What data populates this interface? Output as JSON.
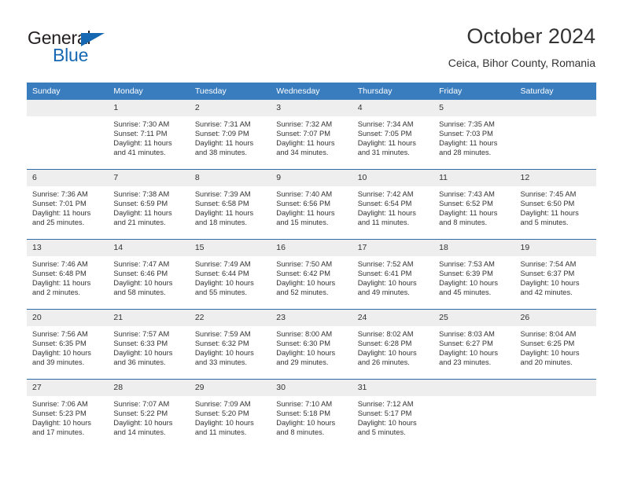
{
  "brand": {
    "name_part1": "General",
    "name_part2": "Blue",
    "accent_color": "#1668b3"
  },
  "header": {
    "month_title": "October 2024",
    "location": "Ceica, Bihor County, Romania"
  },
  "calendar": {
    "header_color": "#3a7dbf",
    "weekday_headers": [
      "Sunday",
      "Monday",
      "Tuesday",
      "Wednesday",
      "Thursday",
      "Friday",
      "Saturday"
    ],
    "weeks": [
      [
        {
          "day": "",
          "blank": true
        },
        {
          "day": "1",
          "sunrise": "Sunrise: 7:30 AM",
          "sunset": "Sunset: 7:11 PM",
          "daylight": "Daylight: 11 hours and 41 minutes."
        },
        {
          "day": "2",
          "sunrise": "Sunrise: 7:31 AM",
          "sunset": "Sunset: 7:09 PM",
          "daylight": "Daylight: 11 hours and 38 minutes."
        },
        {
          "day": "3",
          "sunrise": "Sunrise: 7:32 AM",
          "sunset": "Sunset: 7:07 PM",
          "daylight": "Daylight: 11 hours and 34 minutes."
        },
        {
          "day": "4",
          "sunrise": "Sunrise: 7:34 AM",
          "sunset": "Sunset: 7:05 PM",
          "daylight": "Daylight: 11 hours and 31 minutes."
        },
        {
          "day": "5",
          "sunrise": "Sunrise: 7:35 AM",
          "sunset": "Sunset: 7:03 PM",
          "daylight": "Daylight: 11 hours and 28 minutes."
        },
        {
          "day": "",
          "blank": true
        }
      ],
      [
        {
          "day": "6",
          "sunrise": "Sunrise: 7:36 AM",
          "sunset": "Sunset: 7:01 PM",
          "daylight": "Daylight: 11 hours and 25 minutes."
        },
        {
          "day": "7",
          "sunrise": "Sunrise: 7:38 AM",
          "sunset": "Sunset: 6:59 PM",
          "daylight": "Daylight: 11 hours and 21 minutes."
        },
        {
          "day": "8",
          "sunrise": "Sunrise: 7:39 AM",
          "sunset": "Sunset: 6:58 PM",
          "daylight": "Daylight: 11 hours and 18 minutes."
        },
        {
          "day": "9",
          "sunrise": "Sunrise: 7:40 AM",
          "sunset": "Sunset: 6:56 PM",
          "daylight": "Daylight: 11 hours and 15 minutes."
        },
        {
          "day": "10",
          "sunrise": "Sunrise: 7:42 AM",
          "sunset": "Sunset: 6:54 PM",
          "daylight": "Daylight: 11 hours and 11 minutes."
        },
        {
          "day": "11",
          "sunrise": "Sunrise: 7:43 AM",
          "sunset": "Sunset: 6:52 PM",
          "daylight": "Daylight: 11 hours and 8 minutes."
        },
        {
          "day": "12",
          "sunrise": "Sunrise: 7:45 AM",
          "sunset": "Sunset: 6:50 PM",
          "daylight": "Daylight: 11 hours and 5 minutes."
        }
      ],
      [
        {
          "day": "13",
          "sunrise": "Sunrise: 7:46 AM",
          "sunset": "Sunset: 6:48 PM",
          "daylight": "Daylight: 11 hours and 2 minutes."
        },
        {
          "day": "14",
          "sunrise": "Sunrise: 7:47 AM",
          "sunset": "Sunset: 6:46 PM",
          "daylight": "Daylight: 10 hours and 58 minutes."
        },
        {
          "day": "15",
          "sunrise": "Sunrise: 7:49 AM",
          "sunset": "Sunset: 6:44 PM",
          "daylight": "Daylight: 10 hours and 55 minutes."
        },
        {
          "day": "16",
          "sunrise": "Sunrise: 7:50 AM",
          "sunset": "Sunset: 6:42 PM",
          "daylight": "Daylight: 10 hours and 52 minutes."
        },
        {
          "day": "17",
          "sunrise": "Sunrise: 7:52 AM",
          "sunset": "Sunset: 6:41 PM",
          "daylight": "Daylight: 10 hours and 49 minutes."
        },
        {
          "day": "18",
          "sunrise": "Sunrise: 7:53 AM",
          "sunset": "Sunset: 6:39 PM",
          "daylight": "Daylight: 10 hours and 45 minutes."
        },
        {
          "day": "19",
          "sunrise": "Sunrise: 7:54 AM",
          "sunset": "Sunset: 6:37 PM",
          "daylight": "Daylight: 10 hours and 42 minutes."
        }
      ],
      [
        {
          "day": "20",
          "sunrise": "Sunrise: 7:56 AM",
          "sunset": "Sunset: 6:35 PM",
          "daylight": "Daylight: 10 hours and 39 minutes."
        },
        {
          "day": "21",
          "sunrise": "Sunrise: 7:57 AM",
          "sunset": "Sunset: 6:33 PM",
          "daylight": "Daylight: 10 hours and 36 minutes."
        },
        {
          "day": "22",
          "sunrise": "Sunrise: 7:59 AM",
          "sunset": "Sunset: 6:32 PM",
          "daylight": "Daylight: 10 hours and 33 minutes."
        },
        {
          "day": "23",
          "sunrise": "Sunrise: 8:00 AM",
          "sunset": "Sunset: 6:30 PM",
          "daylight": "Daylight: 10 hours and 29 minutes."
        },
        {
          "day": "24",
          "sunrise": "Sunrise: 8:02 AM",
          "sunset": "Sunset: 6:28 PM",
          "daylight": "Daylight: 10 hours and 26 minutes."
        },
        {
          "day": "25",
          "sunrise": "Sunrise: 8:03 AM",
          "sunset": "Sunset: 6:27 PM",
          "daylight": "Daylight: 10 hours and 23 minutes."
        },
        {
          "day": "26",
          "sunrise": "Sunrise: 8:04 AM",
          "sunset": "Sunset: 6:25 PM",
          "daylight": "Daylight: 10 hours and 20 minutes."
        }
      ],
      [
        {
          "day": "27",
          "sunrise": "Sunrise: 7:06 AM",
          "sunset": "Sunset: 5:23 PM",
          "daylight": "Daylight: 10 hours and 17 minutes."
        },
        {
          "day": "28",
          "sunrise": "Sunrise: 7:07 AM",
          "sunset": "Sunset: 5:22 PM",
          "daylight": "Daylight: 10 hours and 14 minutes."
        },
        {
          "day": "29",
          "sunrise": "Sunrise: 7:09 AM",
          "sunset": "Sunset: 5:20 PM",
          "daylight": "Daylight: 10 hours and 11 minutes."
        },
        {
          "day": "30",
          "sunrise": "Sunrise: 7:10 AM",
          "sunset": "Sunset: 5:18 PM",
          "daylight": "Daylight: 10 hours and 8 minutes."
        },
        {
          "day": "31",
          "sunrise": "Sunrise: 7:12 AM",
          "sunset": "Sunset: 5:17 PM",
          "daylight": "Daylight: 10 hours and 5 minutes."
        },
        {
          "day": "",
          "blank": true
        },
        {
          "day": "",
          "blank": true
        }
      ]
    ]
  }
}
